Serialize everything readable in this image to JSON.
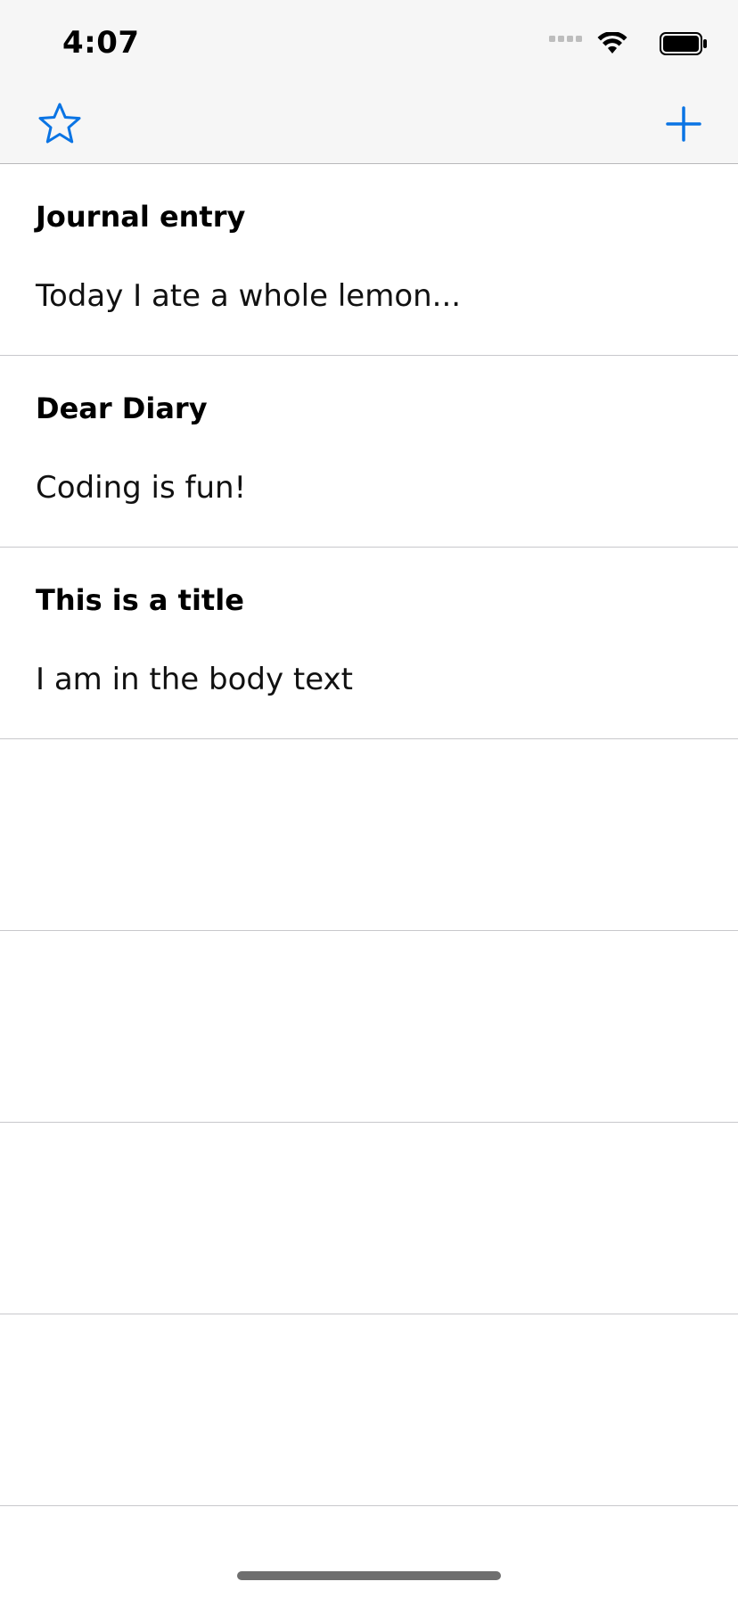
{
  "status_bar": {
    "time": "4:07",
    "signal_icon": "cellular-signal-icon",
    "wifi_icon": "wifi-icon",
    "battery_icon": "battery-icon"
  },
  "toolbar": {
    "left_icon": "star-icon",
    "right_icon": "plus-icon",
    "accent_color": "#0a74e4"
  },
  "entries": [
    {
      "title": "Journal entry",
      "body": "Today I ate a whole lemon..."
    },
    {
      "title": "Dear Diary",
      "body": "Coding is fun!"
    },
    {
      "title": "This is a title",
      "body": "I am in the body text"
    },
    {
      "title": "",
      "body": ""
    },
    {
      "title": "",
      "body": ""
    },
    {
      "title": "",
      "body": ""
    },
    {
      "title": "",
      "body": ""
    }
  ]
}
